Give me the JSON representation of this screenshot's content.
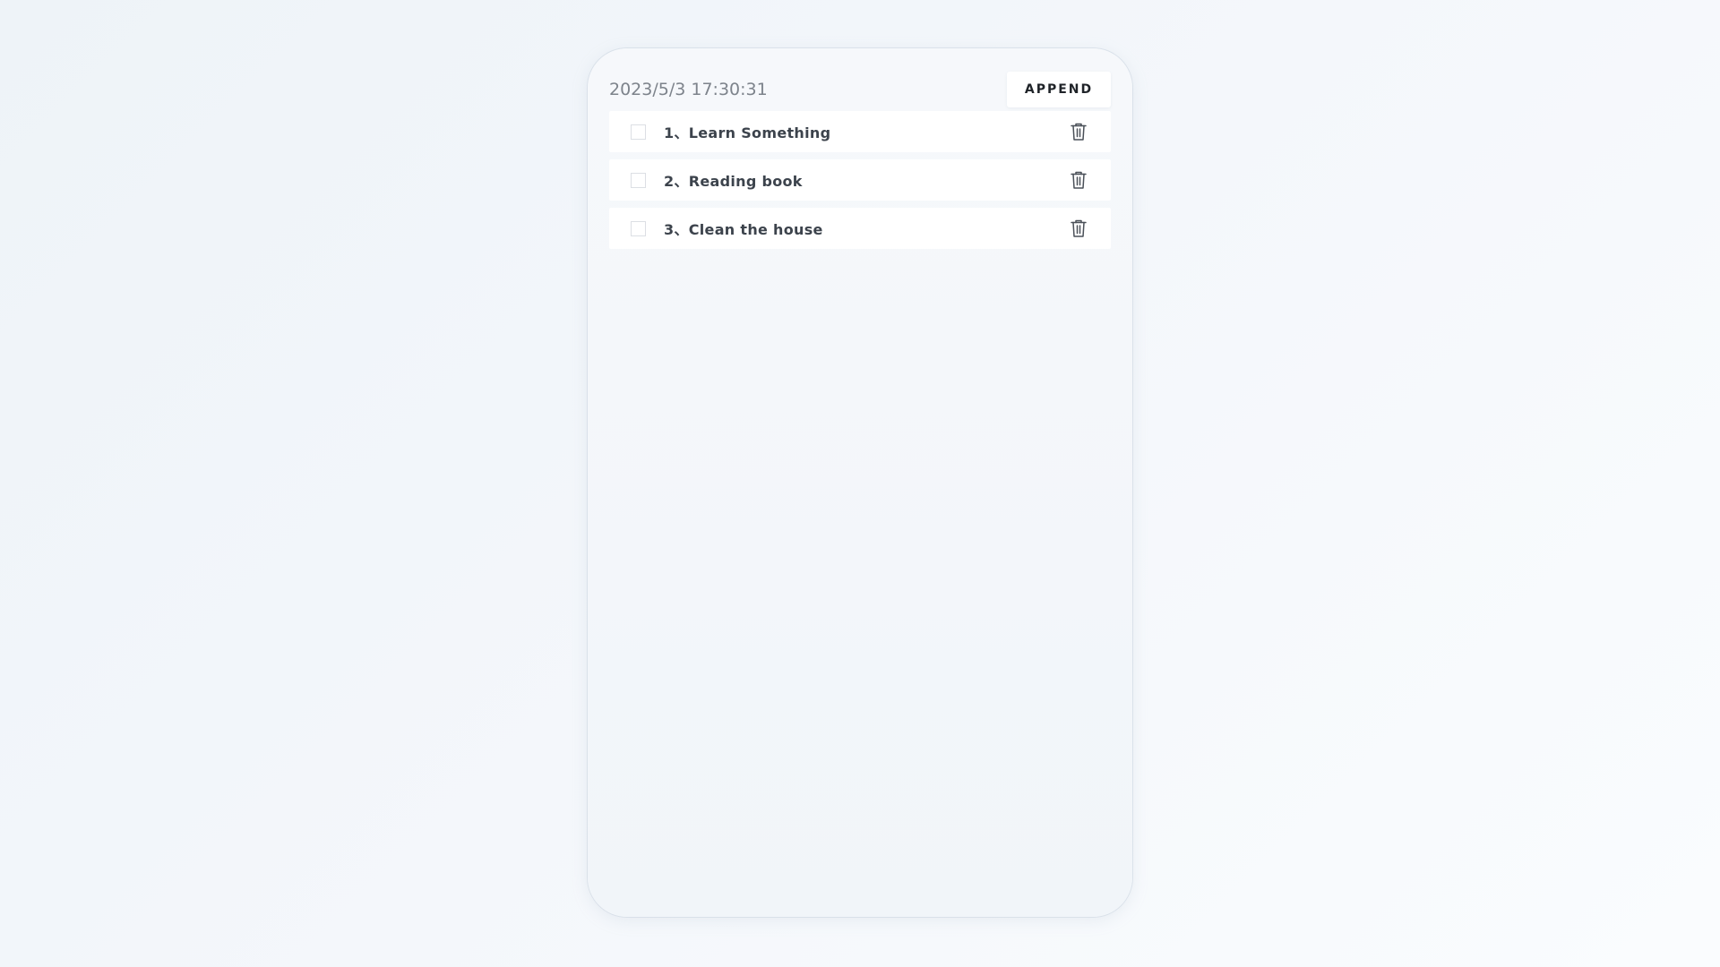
{
  "header": {
    "datetime": "2023/5/3 17:30:31",
    "append_label": "APPEND"
  },
  "todos": [
    {
      "label": "1、Learn Something",
      "checked": false
    },
    {
      "label": "2、Reading book",
      "checked": false
    },
    {
      "label": "3、Clean the house",
      "checked": false
    }
  ],
  "icons": {
    "delete": "trash-icon"
  },
  "colors": {
    "text": "#3c434c",
    "muted": "#7d838b",
    "card": "#ffffff"
  }
}
